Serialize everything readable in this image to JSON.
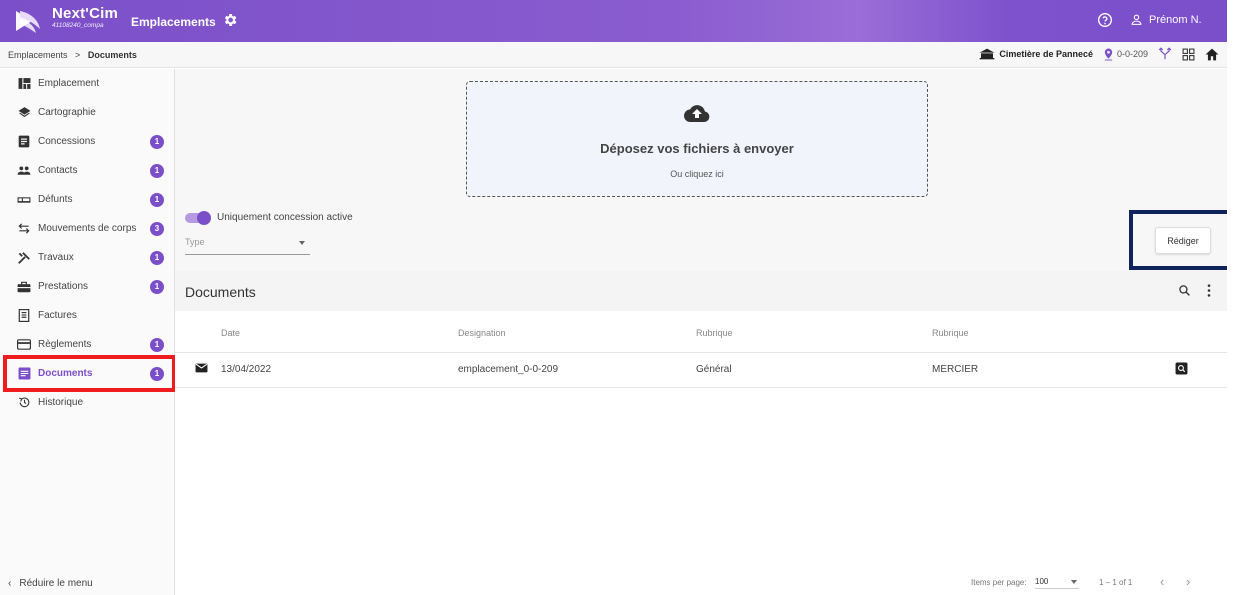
{
  "app": {
    "brand_name": "Next'Cim",
    "brand_sub": "41108240_compa",
    "module_title": "Emplacements",
    "user_name": "Prénom N."
  },
  "breadcrumb": {
    "parent": "Emplacements",
    "separator": ">",
    "current": "Documents"
  },
  "context": {
    "cemetery": "Cimetière de Pannecé",
    "location": "0-0-209"
  },
  "sidebar": {
    "items": [
      {
        "label": "Emplacement",
        "icon": "grid-icon",
        "badge": ""
      },
      {
        "label": "Cartographie",
        "icon": "layers-icon",
        "badge": ""
      },
      {
        "label": "Concessions",
        "icon": "document-icon",
        "badge": "1"
      },
      {
        "label": "Contacts",
        "icon": "people-icon",
        "badge": "1"
      },
      {
        "label": "Défunts",
        "icon": "bed-icon",
        "badge": "1"
      },
      {
        "label": "Mouvements de corps",
        "icon": "swap-icon",
        "badge": "3"
      },
      {
        "label": "Travaux",
        "icon": "tools-icon",
        "badge": "1"
      },
      {
        "label": "Prestations",
        "icon": "briefcase-icon",
        "badge": "1"
      },
      {
        "label": "Factures",
        "icon": "receipt-icon",
        "badge": ""
      },
      {
        "label": "Règlements",
        "icon": "card-icon",
        "badge": "1"
      },
      {
        "label": "Documents",
        "icon": "pdf-icon",
        "badge": "1",
        "active": true
      },
      {
        "label": "Historique",
        "icon": "history-icon",
        "badge": ""
      }
    ],
    "reduce_label": "Réduire le menu"
  },
  "upload": {
    "title": "Déposez vos fichiers à envoyer",
    "subtitle": "Ou cliquez ici"
  },
  "filters": {
    "toggle_label": "Uniquement concession active",
    "type_placeholder": "Type"
  },
  "actions": {
    "rediger_label": "Rédiger"
  },
  "documents": {
    "title": "Documents",
    "columns": [
      "Date",
      "Designation",
      "Rubrique",
      "Rubrique"
    ],
    "rows": [
      {
        "date": "13/04/2022",
        "designation": "emplacement_0-0-209",
        "rubrique1": "Général",
        "rubrique2": "MERCIER"
      }
    ]
  },
  "paginator": {
    "items_per_page_label": "Items per page:",
    "items_per_page_value": "100",
    "range": "1 – 1 of 1"
  },
  "colors": {
    "accent": "#7b4fc9",
    "highlight_red": "#ee1c1c",
    "highlight_navy": "#10235a"
  }
}
